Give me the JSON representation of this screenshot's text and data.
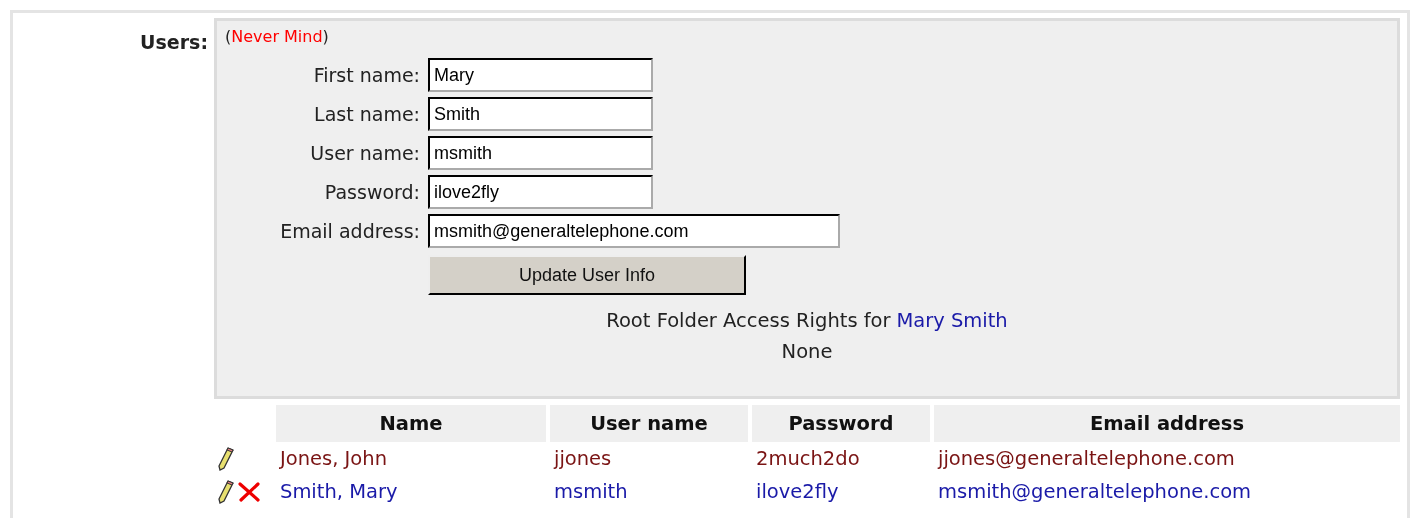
{
  "section_label": "Users:",
  "cancel_link": {
    "open": "(",
    "label": "Never Mind",
    "close": ")"
  },
  "form": {
    "fields": [
      {
        "label": "First name:",
        "value": "Mary",
        "wide": false
      },
      {
        "label": "Last name:",
        "value": "Smith",
        "wide": false
      },
      {
        "label": "User name:",
        "value": "msmith",
        "wide": false
      },
      {
        "label": "Password:",
        "value": "ilove2fly",
        "wide": false
      },
      {
        "label": "Email address:",
        "value": "msmith@generaltelephone.com",
        "wide": true
      }
    ],
    "submit": "Update User Info"
  },
  "access_rights": {
    "prefix": "Root Folder Access Rights for",
    "user": "Mary Smith",
    "value": "None"
  },
  "table": {
    "columns": [
      "Name",
      "User name",
      "Password",
      "Email address"
    ],
    "rows": [
      {
        "cells": [
          "Jones, John",
          "jjones",
          "2much2do",
          "jjones@generaltelephone.com"
        ],
        "selected": false,
        "deletable": false
      },
      {
        "cells": [
          "Smith, Mary",
          "msmith",
          "ilove2fly",
          "msmith@generaltelephone.com"
        ],
        "selected": true,
        "deletable": true
      }
    ]
  }
}
